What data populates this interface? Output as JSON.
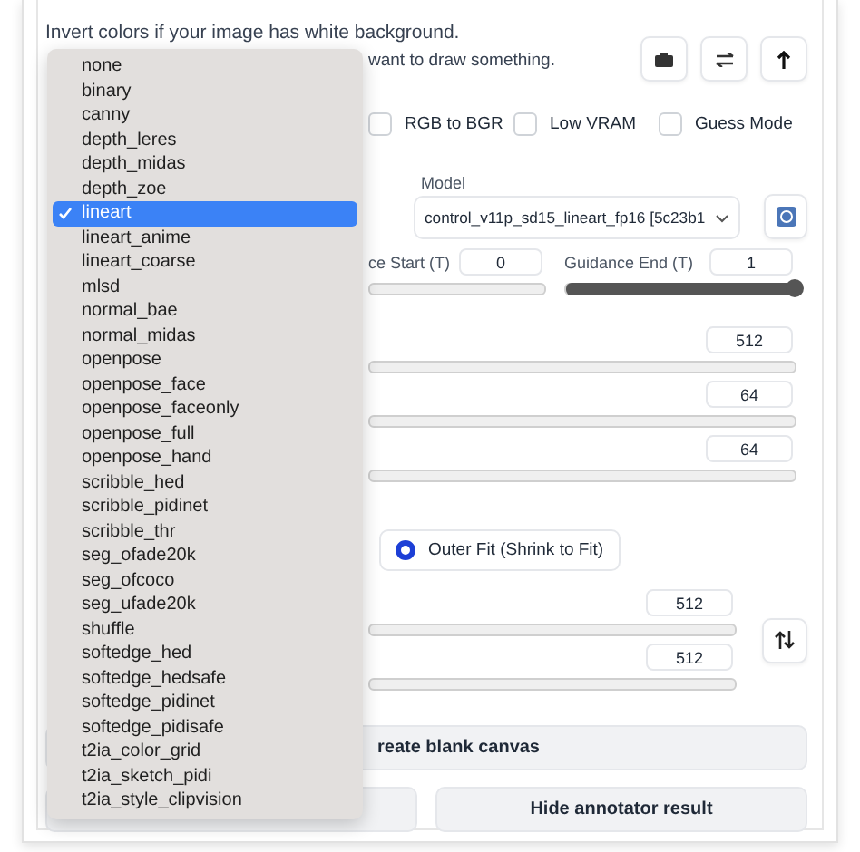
{
  "hint_lines": [
    "Invert colors if your image has white background.",
    "want to draw something."
  ],
  "options": [
    {
      "label": "RGB to BGR",
      "checked": false
    },
    {
      "label": "Low VRAM",
      "checked": false
    },
    {
      "label": "Guess Mode",
      "checked": false
    }
  ],
  "model": {
    "label": "Model",
    "value": "control_v11p_sd15_lineart_fp16 [5c23b1"
  },
  "guidance": [
    {
      "label": "ce Start (T)",
      "value": "0"
    },
    {
      "label": "Guidance End (T)",
      "value": "1",
      "level": 1
    }
  ],
  "sliders": [
    {
      "value": "512"
    },
    {
      "value": "64"
    },
    {
      "value": "64"
    }
  ],
  "resize_mode": [
    {
      "label": "Outer Fit (Shrink to Fit)",
      "selected": true
    }
  ],
  "canvas_sliders": [
    {
      "value": "512"
    },
    {
      "value": "512"
    }
  ],
  "create_button": "reate blank canvas",
  "annotator_button": "Hide annotator result",
  "preprocessor_menu": [
    {
      "label": "none",
      "selected": false
    },
    {
      "label": "binary",
      "selected": false
    },
    {
      "label": "canny",
      "selected": false
    },
    {
      "label": "depth_leres",
      "selected": false
    },
    {
      "label": "depth_midas",
      "selected": false
    },
    {
      "label": "depth_zoe",
      "selected": false
    },
    {
      "label": "lineart",
      "selected": true
    },
    {
      "label": "lineart_anime",
      "selected": false
    },
    {
      "label": "lineart_coarse",
      "selected": false
    },
    {
      "label": "mlsd",
      "selected": false
    },
    {
      "label": "normal_bae",
      "selected": false
    },
    {
      "label": "normal_midas",
      "selected": false
    },
    {
      "label": "openpose",
      "selected": false
    },
    {
      "label": "openpose_face",
      "selected": false
    },
    {
      "label": "openpose_faceonly",
      "selected": false
    },
    {
      "label": "openpose_full",
      "selected": false
    },
    {
      "label": "openpose_hand",
      "selected": false
    },
    {
      "label": "scribble_hed",
      "selected": false
    },
    {
      "label": "scribble_pidinet",
      "selected": false
    },
    {
      "label": "scribble_thr",
      "selected": false
    },
    {
      "label": "seg_ofade20k",
      "selected": false
    },
    {
      "label": "seg_ofcoco",
      "selected": false
    },
    {
      "label": "seg_ufade20k",
      "selected": false
    },
    {
      "label": "shuffle",
      "selected": false
    },
    {
      "label": "softedge_hed",
      "selected": false
    },
    {
      "label": "softedge_hedsafe",
      "selected": false
    },
    {
      "label": "softedge_pidinet",
      "selected": false
    },
    {
      "label": "softedge_pidisafe",
      "selected": false
    },
    {
      "label": "t2ia_color_grid",
      "selected": false
    },
    {
      "label": "t2ia_sketch_pidi",
      "selected": false
    },
    {
      "label": "t2ia_style_clipvision",
      "selected": false
    }
  ]
}
